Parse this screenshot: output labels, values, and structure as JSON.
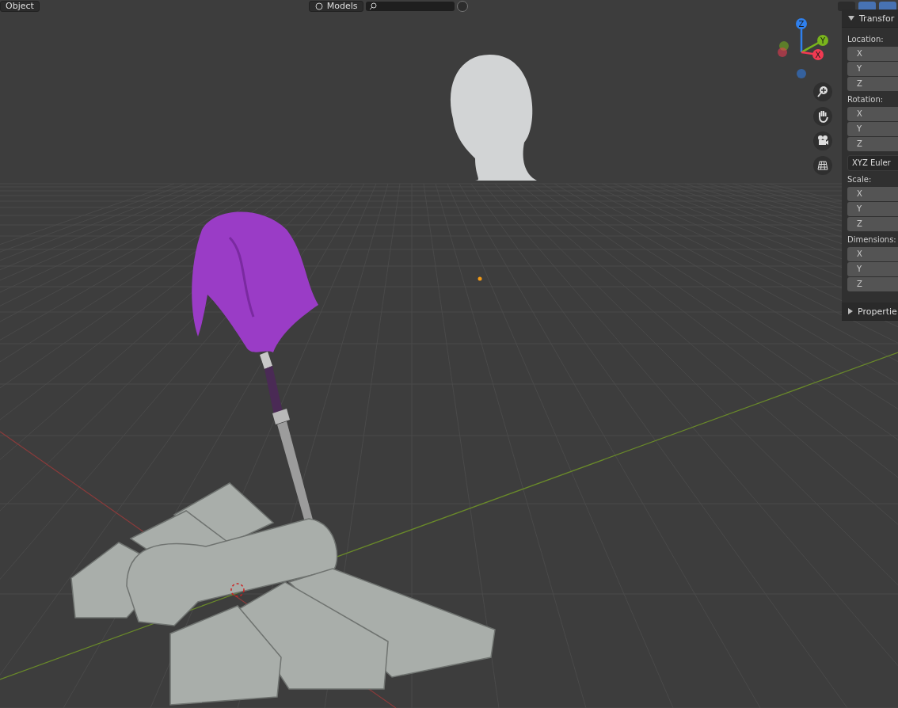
{
  "header": {
    "mode": "Object",
    "collection": "Models"
  },
  "gizmo": {
    "axes": [
      {
        "label": "Z",
        "color": "#2f80ed"
      },
      {
        "label": "Y",
        "color": "#79b51c"
      },
      {
        "label": "X",
        "color": "#f23a52"
      }
    ]
  },
  "sidebar": {
    "panels": [
      {
        "title": "Transfor",
        "expanded": true,
        "groups": [
          {
            "label": "Location:",
            "fields": [
              "X",
              "Y",
              "Z"
            ]
          },
          {
            "label": "Rotation:",
            "fields": [
              "X",
              "Y",
              "Z"
            ],
            "dropdown": "XYZ Euler"
          },
          {
            "label": "Scale:",
            "fields": [
              "X",
              "Y",
              "Z"
            ]
          },
          {
            "label": "Dimensions:",
            "fields": [
              "X",
              "Y",
              "Z"
            ]
          }
        ]
      },
      {
        "title": "Propertie",
        "expanded": false
      }
    ]
  }
}
